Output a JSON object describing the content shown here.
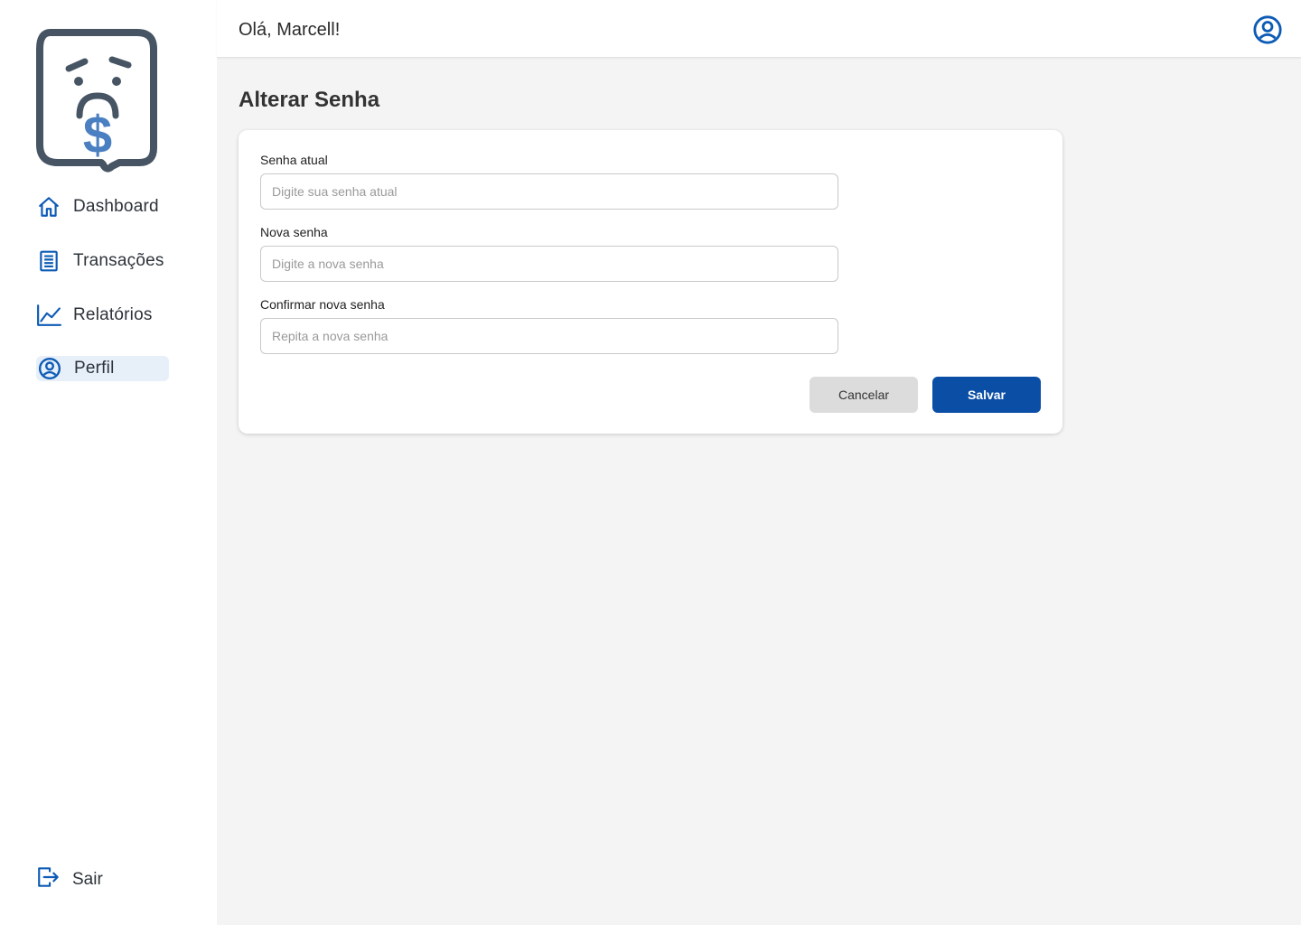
{
  "header": {
    "greeting": "Olá, Marcell!"
  },
  "sidebar": {
    "items": [
      {
        "label": "Dashboard",
        "icon": "home-icon"
      },
      {
        "label": "Transações",
        "icon": "receipt-icon"
      },
      {
        "label": "Relatórios",
        "icon": "chart-line-icon"
      },
      {
        "label": "Perfil",
        "icon": "user-circle-icon",
        "active": true
      }
    ],
    "logout_label": "Sair"
  },
  "page": {
    "title": "Alterar Senha"
  },
  "form": {
    "current": {
      "label": "Senha atual",
      "placeholder": "Digite sua senha atual",
      "value": ""
    },
    "new": {
      "label": "Nova senha",
      "placeholder": "Digite a nova senha",
      "value": ""
    },
    "confirm": {
      "label": "Confirmar nova senha",
      "placeholder": "Repita a nova senha",
      "value": ""
    },
    "cancel_label": "Cancelar",
    "save_label": "Salvar"
  },
  "colors": {
    "primary": "#0a4ea6",
    "icon_blue": "#0d5bb5",
    "active_bg": "#e7eff9",
    "logo_outline": "#465463",
    "logo_dollar": "#4a7fc1"
  }
}
